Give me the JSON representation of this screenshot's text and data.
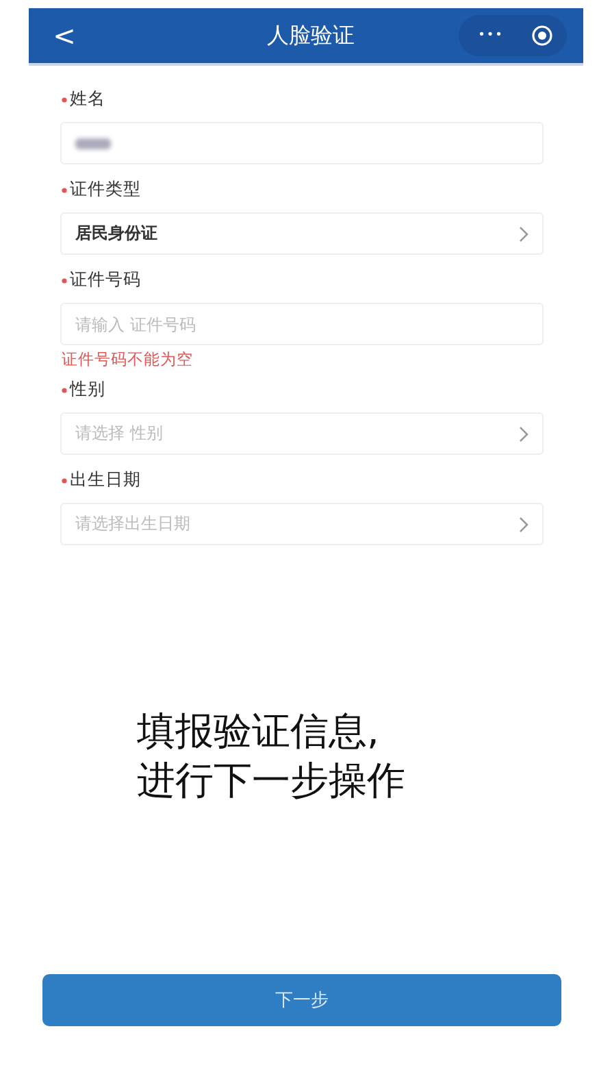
{
  "header": {
    "back": "<",
    "title": "人脸验证",
    "more": "•••"
  },
  "fields": [
    {
      "kind": "text",
      "label": "姓名",
      "required": true,
      "value_blurred": true
    },
    {
      "kind": "select",
      "label": "证件类型",
      "required": true,
      "value": "居民身份证"
    },
    {
      "kind": "text",
      "label": "证件号码",
      "required": true,
      "placeholder": "请输入 证件号码",
      "error": "证件号码不能为空"
    },
    {
      "kind": "select",
      "label": "性别",
      "required": true,
      "placeholder": "请选择 性别"
    },
    {
      "kind": "select",
      "label": "出生日期",
      "required": true,
      "placeholder": "请选择出生日期"
    }
  ],
  "caption": [
    "填报验证信息,",
    "进行下一步操作"
  ],
  "next_button": "下一步"
}
